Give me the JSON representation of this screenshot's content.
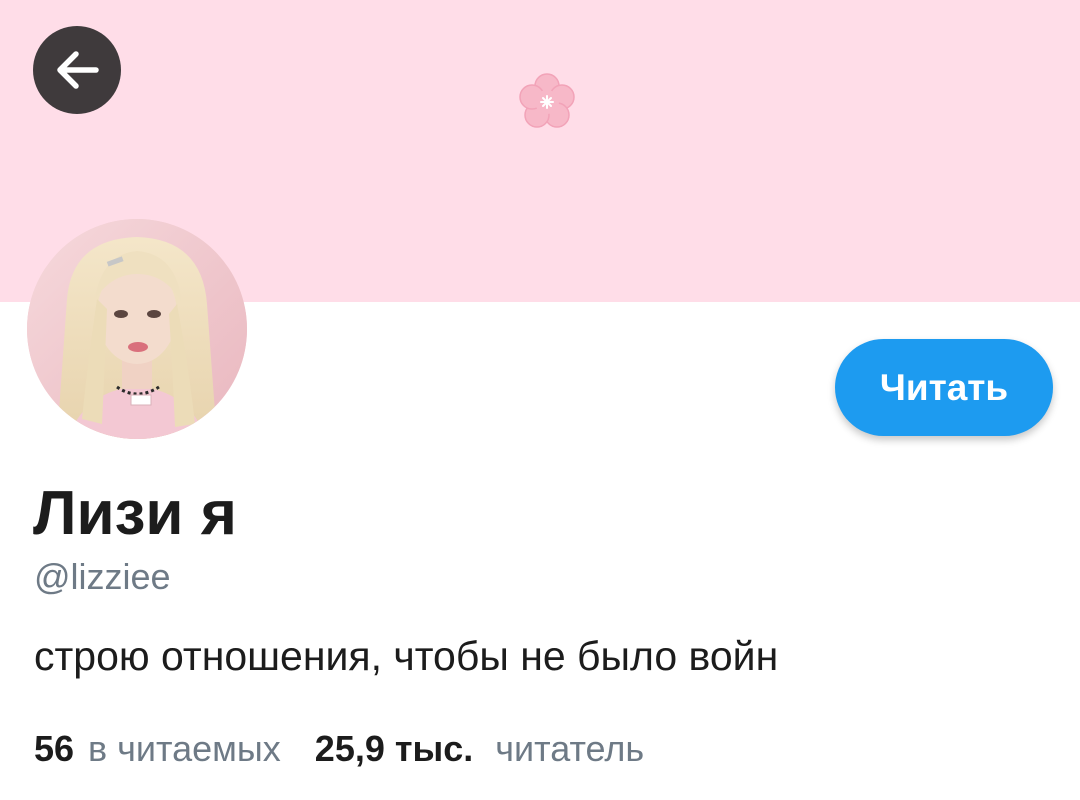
{
  "profile": {
    "display_name": "Лизи я",
    "handle": "@lizziee",
    "bio": "строю отношения, чтобы не было войн",
    "follow_button_label": "Читать"
  },
  "stats": {
    "following_count": "56",
    "following_label": "в читаемых",
    "followers_count": "25,9 тыс.",
    "followers_label": "читатель"
  },
  "colors": {
    "banner": "#ffdde8",
    "accent": "#1d9bf0",
    "back_button": "#3f3a3c",
    "muted_text": "#6e7a86",
    "primary_text": "#1c1c1c"
  },
  "icons": {
    "back": "arrow-left-icon",
    "banner_decoration": "sakura-flower-icon"
  }
}
